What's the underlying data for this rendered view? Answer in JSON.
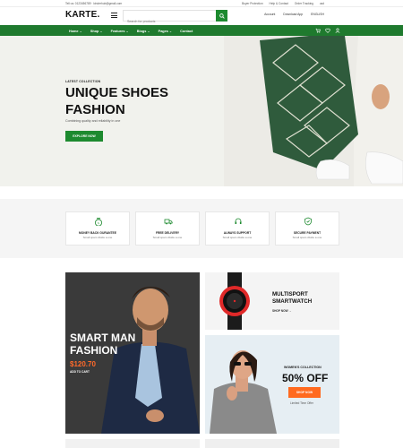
{
  "topbar": {
    "contact": "Tell us: 0123456789 · kinderhub@gmail.com",
    "links": [
      "Buyer Protection",
      "Help & Contact",
      "Order Tracking",
      "usd"
    ]
  },
  "header": {
    "logo": "KARTE.",
    "search_placeholder": "Search for products",
    "account": "Account",
    "wishlist": "Download App",
    "currency": "ENGLISH"
  },
  "nav": {
    "items": [
      "Home ⌄",
      "Shop ⌄",
      "Features ⌄",
      "Blogs ⌄",
      "Pages ⌄",
      "Contact"
    ]
  },
  "hero": {
    "kicker": "LATEST COLLECTION",
    "title_line1": "UNIQUE SHOES",
    "title_line2": "FASHION",
    "subtitle": "Combining quality and reliability in one",
    "cta": "EXPLORE NOW"
  },
  "features": [
    {
      "title": "MONEY BACK GURANTEE",
      "sub": "Small spam divide a one",
      "icon": "money-bag-icon"
    },
    {
      "title": "FREE DELIVERY",
      "sub": "Small spam divide a one",
      "icon": "truck-icon"
    },
    {
      "title": "ALWAYS SUPPORT",
      "sub": "Small spam divide a one",
      "icon": "headset-icon"
    },
    {
      "title": "SECURE PAYMENT",
      "sub": "Small spam divide a one",
      "icon": "shield-icon"
    }
  ],
  "promo": {
    "left_title1": "SMART MAN",
    "left_title2": "FASHION",
    "left_price": "$120.70",
    "left_link": "ADD TO CART",
    "watch_title1": "MULTISPORT",
    "watch_title2": "SMARTWATCH",
    "watch_link": "SHOP NOW →",
    "women_kicker": "WOMEN'S COLLECTION",
    "women_off": "50% OFF",
    "women_btn": "SHOP NOW",
    "women_limit": "Limited Time Offer"
  },
  "colors": {
    "primary_green": "#1d8a2f",
    "nav_green": "#1f7a2e",
    "accent_orange": "#ff6a1f"
  }
}
